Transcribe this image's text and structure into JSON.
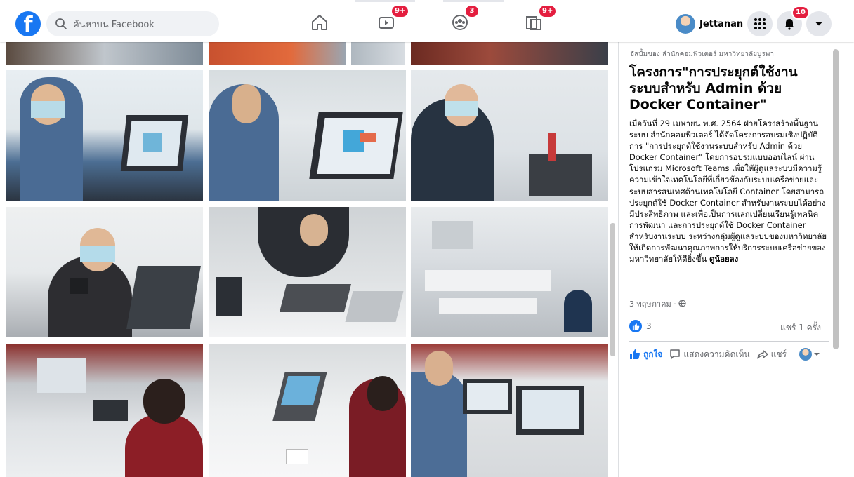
{
  "header": {
    "search_placeholder": "ค้นหาบน Facebook",
    "nav_badges": {
      "watch": "9+",
      "groups": "3",
      "gaming": "9+"
    },
    "profile_name": "Jettanan",
    "notifications_badge": "10"
  },
  "grid": {
    "photos": [
      {
        "name": "photo-top-1"
      },
      {
        "name": "photo-top-2"
      },
      {
        "name": "photo-top-3"
      },
      {
        "name": "photo-top-4"
      },
      {
        "name": "photo-r1-1"
      },
      {
        "name": "photo-r1-2"
      },
      {
        "name": "photo-r1-3"
      },
      {
        "name": "photo-r2-1"
      },
      {
        "name": "photo-r2-2"
      },
      {
        "name": "photo-r2-3"
      },
      {
        "name": "photo-r3-1"
      },
      {
        "name": "photo-r3-2"
      },
      {
        "name": "photo-r3-3"
      }
    ]
  },
  "post": {
    "album_label": "อัลบั้มของ สำนักคอมพิวเตอร์ มหาวิทยาลัยบูรพา",
    "title": "โครงการ\"การประยุกต์ใช้งานระบบสำหรับ Admin ด้วย Docker Container\"",
    "body": "เมื่อวันที่ 29 เมษายน พ.ศ. 2564 ฝ่ายโครงสร้างพื้นฐานระบบ สำนักคอมพิวเตอร์ ได้จัดโครงการอบรมเชิงปฏิบัติการ \"การประยุกต์ใช้งานระบบสำหรับ Admin ด้วย Docker Container\" โดยการอบรมแบบออนไลน์ ผ่านโปรแกรม Microsoft Teams เพื่อให้ผู้ดูแลระบบมีความรู้ ความเข้าใจเทคโนโลยีที่เกี่ยวข้องกับระบบเครือข่ายและระบบสารสนเทศด้านเทคโนโลยี Container โดยสามารถประยุกต์ใช้ Docker Container สำหรับงานระบบได้อย่างมีประสิทธิภาพ และเพื่อเป็นการแลกเปลี่ยนเรียนรู้เทคนิคการพัฒนา และการประยุกต์ใช้ Docker Container สำหรับงานระบบ ระหว่างกลุ่มผู้ดูแลระบบของมหาวิทยาลัย ให้เกิดการพัฒนาคุณภาพการให้บริการระบบเครือข่ายของมหาวิทยาลัยให้ดียิ่งขึ้น",
    "see_less": "ดูน้อยลง",
    "date": "3 พฤษภาคม ·",
    "like_count": "3",
    "share_count": "แชร์ 1 ครั้ง",
    "actions": {
      "like": "ถูกใจ",
      "comment": "แสดงความคิดเห็น",
      "share": "แชร์"
    }
  },
  "colors": {
    "brand": "#1877f2",
    "badge": "#e41e3f",
    "bg": "#f0f2f5"
  }
}
